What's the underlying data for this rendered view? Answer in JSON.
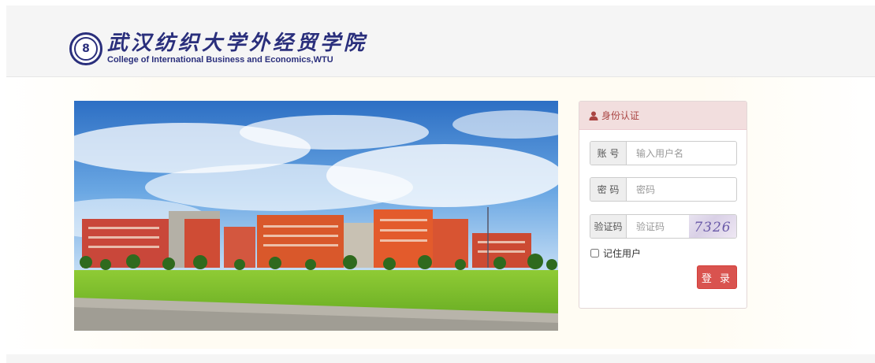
{
  "header": {
    "title_cn": "武汉纺织大学外经贸学院",
    "title_en": "College of International Business and Economics,WTU",
    "seal_glyph": "8"
  },
  "login": {
    "heading": "身份认证",
    "account": {
      "label": "账 号",
      "placeholder": "输入用户名"
    },
    "password": {
      "label": "密 码",
      "placeholder": "密码"
    },
    "captcha": {
      "label": "验证码",
      "placeholder": "验证码",
      "image_text": "7326"
    },
    "remember_label": "记住用户",
    "submit_label": "登 录"
  },
  "colors": {
    "brand_navy": "#2a2f7c",
    "panel_heading_bg": "#f2dede",
    "panel_heading_text": "#a94442",
    "button_red": "#d9534f"
  }
}
